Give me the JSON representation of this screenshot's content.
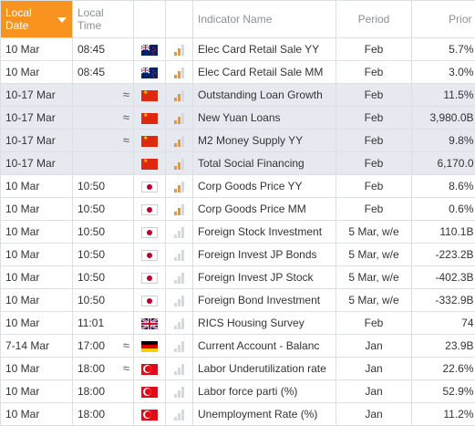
{
  "headers": {
    "local_date": "Local Date",
    "local_time": "Local Time",
    "indicator_name": "Indicator Name",
    "period": "Period",
    "prior": "Prior"
  },
  "colors": {
    "accent": "#f7931e",
    "shaded_row": "#e6e9ef",
    "grid_line": "#dcdfe4"
  },
  "rows": [
    {
      "date": "10 Mar",
      "time": "08:45",
      "approx": "",
      "flag": "nz-flag-icon",
      "importance": 2,
      "name": "Elec Card Retail Sale YY",
      "period": "Feb",
      "prior": "5.7%",
      "shaded": false
    },
    {
      "date": "10 Mar",
      "time": "08:45",
      "approx": "",
      "flag": "nz-flag-icon",
      "importance": 2,
      "name": "Elec Card Retail Sale MM",
      "period": "Feb",
      "prior": "3.0%",
      "shaded": false
    },
    {
      "date": "10-17 Mar",
      "time": "",
      "approx": "≈",
      "flag": "cn-flag-icon",
      "importance": 2,
      "name": "Outstanding Loan Growth",
      "period": "Feb",
      "prior": "11.5%",
      "shaded": true
    },
    {
      "date": "10-17 Mar",
      "time": "",
      "approx": "≈",
      "flag": "cn-flag-icon",
      "importance": 2,
      "name": "New Yuan Loans",
      "period": "Feb",
      "prior": "3,980.0B",
      "shaded": true
    },
    {
      "date": "10-17 Mar",
      "time": "",
      "approx": "≈",
      "flag": "cn-flag-icon",
      "importance": 2,
      "name": "M2 Money Supply YY",
      "period": "Feb",
      "prior": "9.8%",
      "shaded": true
    },
    {
      "date": "10-17 Mar",
      "time": "",
      "approx": "",
      "flag": "cn-flag-icon",
      "importance": 2,
      "name": "Total Social Financing",
      "period": "Feb",
      "prior": "6,170.0",
      "shaded": true
    },
    {
      "date": "10 Mar",
      "time": "10:50",
      "approx": "",
      "flag": "jp-flag-icon",
      "importance": 2,
      "name": "Corp Goods Price YY",
      "period": "Feb",
      "prior": "8.6%",
      "shaded": false
    },
    {
      "date": "10 Mar",
      "time": "10:50",
      "approx": "",
      "flag": "jp-flag-icon",
      "importance": 2,
      "name": "Corp Goods Price MM",
      "period": "Feb",
      "prior": "0.6%",
      "shaded": false
    },
    {
      "date": "10 Mar",
      "time": "10:50",
      "approx": "",
      "flag": "jp-flag-icon",
      "importance": 0,
      "name": "Foreign Stock Investment",
      "period": "5 Mar, w/e",
      "prior": "110.1B",
      "shaded": false
    },
    {
      "date": "10 Mar",
      "time": "10:50",
      "approx": "",
      "flag": "jp-flag-icon",
      "importance": 0,
      "name": "Foreign Invest JP Bonds",
      "period": "5 Mar, w/e",
      "prior": "-223.2B",
      "shaded": false
    },
    {
      "date": "10 Mar",
      "time": "10:50",
      "approx": "",
      "flag": "jp-flag-icon",
      "importance": 0,
      "name": "Foreign Invest JP Stock",
      "period": "5 Mar, w/e",
      "prior": "-402.3B",
      "shaded": false
    },
    {
      "date": "10 Mar",
      "time": "10:50",
      "approx": "",
      "flag": "jp-flag-icon",
      "importance": 0,
      "name": "Foreign Bond Investment",
      "period": "5 Mar, w/e",
      "prior": "-332.9B",
      "shaded": false
    },
    {
      "date": "10 Mar",
      "time": "11:01",
      "approx": "",
      "flag": "uk-flag-icon",
      "importance": 0,
      "name": "RICS Housing Survey",
      "period": "Feb",
      "prior": "74",
      "shaded": false
    },
    {
      "date": "7-14 Mar",
      "time": "17:00",
      "approx": "≈",
      "flag": "de-flag-icon",
      "importance": 0,
      "name": "Current Account - Balanc",
      "period": "Jan",
      "prior": "23.9B",
      "shaded": false
    },
    {
      "date": "10 Mar",
      "time": "18:00",
      "approx": "≈",
      "flag": "tr-flag-icon",
      "importance": 0,
      "name": "Labor Underutilization rate",
      "period": "Jan",
      "prior": "22.6%",
      "shaded": false
    },
    {
      "date": "10 Mar",
      "time": "18:00",
      "approx": "",
      "flag": "tr-flag-icon",
      "importance": 0,
      "name": "Labor force parti (%)",
      "period": "Jan",
      "prior": "52.9%",
      "shaded": false
    },
    {
      "date": "10 Mar",
      "time": "18:00",
      "approx": "",
      "flag": "tr-flag-icon",
      "importance": 0,
      "name": "Unemployment Rate (%)",
      "period": "Jan",
      "prior": "11.2%",
      "shaded": false
    }
  ]
}
